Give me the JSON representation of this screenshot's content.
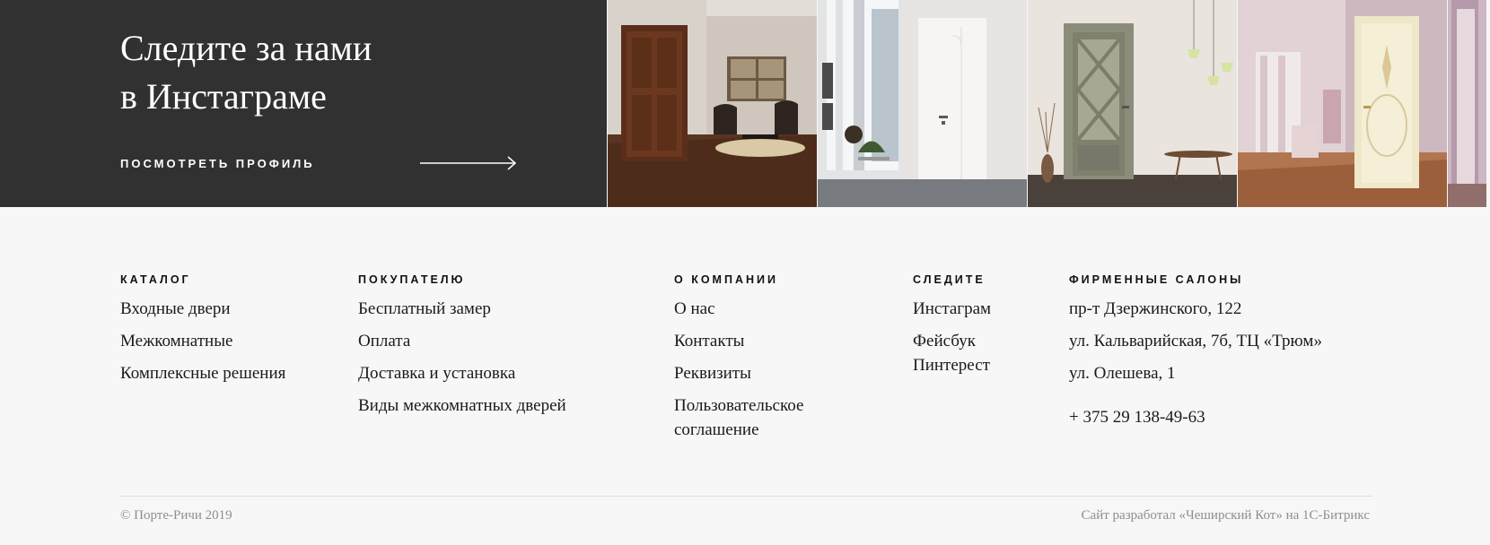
{
  "instagram": {
    "title_line1": "Следите за нами",
    "title_line2": "в Инстаграме",
    "link_label": "ПОСМОТРЕТЬ ПРОФИЛЬ"
  },
  "footer": {
    "catalog": {
      "heading": "КАТАЛОГ",
      "items": [
        "Входные двери",
        "Межкомнатные",
        "Комплексные решения"
      ]
    },
    "buyer": {
      "heading": "ПОКУПАТЕЛЮ",
      "items": [
        "Бесплатный замер",
        "Оплата",
        "Доставка и установка",
        "Виды межкомнатных дверей"
      ]
    },
    "company": {
      "heading": "О КОМПАНИИ",
      "items": [
        "О нас",
        "Контакты",
        "Реквизиты",
        "Пользовательское соглашение"
      ]
    },
    "follow": {
      "heading": "СЛЕДИТЕ",
      "items": [
        "Инстаграм",
        "Фейсбук",
        "Пинтерест"
      ]
    },
    "salons": {
      "heading": "ФИРМЕННЫЕ САЛОНЫ",
      "items": [
        "пр-т Дзержинского, 122",
        "ул. Кальварийская, 7б, ТЦ «Трюм»",
        "ул. Олешева, 1"
      ],
      "phone": "+ 375 29 138-49-63"
    },
    "copyright": "© Порте-Ричи 2019",
    "developer": "Сайт разработал «Чеширский Кот» на 1С-Битрикс"
  }
}
